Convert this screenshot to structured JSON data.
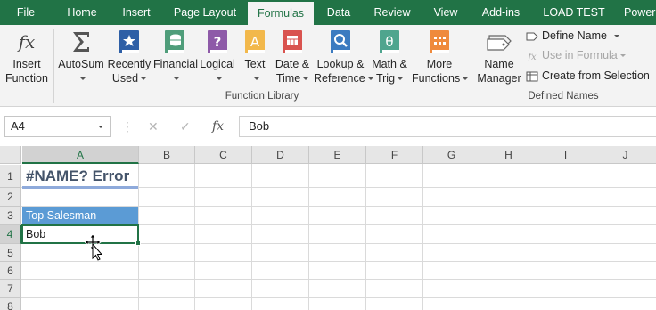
{
  "tabs": [
    "File",
    "Home",
    "Insert",
    "Page Layout",
    "Formulas",
    "Data",
    "Review",
    "View",
    "Add-ins",
    "LOAD TEST",
    "Power"
  ],
  "active_tab": "Formulas",
  "colors": {
    "accent": "#217346",
    "header_fill": "#5b9bd5",
    "title_text": "#44546a"
  },
  "ribbon": {
    "insert_function": {
      "line1": "Insert",
      "line2": "Function",
      "icon": "fx-icon"
    },
    "function_library": {
      "group_label": "Function Library",
      "buttons": [
        {
          "line1": "AutoSum",
          "line2": "",
          "icon": "sigma-icon",
          "dropdown": true
        },
        {
          "line1": "Recently",
          "line2": "Used",
          "icon": "star-book-icon",
          "dropdown": true
        },
        {
          "line1": "Financial",
          "line2": "",
          "icon": "coins-book-icon",
          "dropdown": true
        },
        {
          "line1": "Logical",
          "line2": "",
          "icon": "question-book-icon",
          "dropdown": true
        },
        {
          "line1": "Text",
          "line2": "",
          "icon": "text-book-icon",
          "dropdown": true
        },
        {
          "line1": "Date &",
          "line2": "Time",
          "icon": "calendar-book-icon",
          "dropdown": true
        },
        {
          "line1": "Lookup &",
          "line2": "Reference",
          "icon": "magnifier-book-icon",
          "dropdown": true
        },
        {
          "line1": "Math &",
          "line2": "Trig",
          "icon": "theta-book-icon",
          "dropdown": true
        },
        {
          "line1": "More",
          "line2": "Functions",
          "icon": "more-book-icon",
          "dropdown": true
        }
      ]
    },
    "defined_names": {
      "group_label": "Defined Names",
      "name_manager": {
        "line1": "Name",
        "line2": "Manager",
        "icon": "tag-icon"
      },
      "define_name": "Define Name",
      "use_in_formula": "Use in Formula",
      "create_from_selection": "Create from Selection"
    }
  },
  "formula_bar": {
    "name_box": "A4",
    "cancel_glyph": "✕",
    "enter_glyph": "✓",
    "fx_glyph": "fx",
    "content": "Bob"
  },
  "grid": {
    "columns": [
      "A",
      "B",
      "C",
      "D",
      "E",
      "F",
      "G",
      "H",
      "I",
      "J"
    ],
    "rows": [
      "1",
      "2",
      "3",
      "4",
      "5",
      "6",
      "7",
      "8"
    ],
    "selected_column": "A",
    "selected_row": "4",
    "cells": {
      "A1": "#NAME? Error",
      "A3": "Top Salesman",
      "A4": "Bob"
    }
  }
}
